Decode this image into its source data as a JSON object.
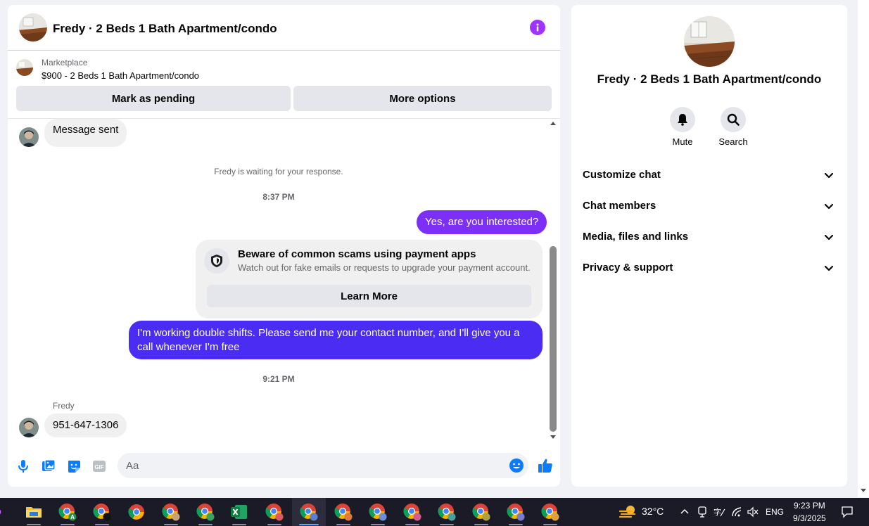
{
  "chat": {
    "title": "Fredy · 2 Beds 1 Bath Apartment/condo",
    "marketplace_label": "Marketplace",
    "listing": "$900 - 2 Beds 1 Bath Apartment/condo",
    "mark_pending": "Mark as pending",
    "more_options": "More options",
    "messages": {
      "m1": "Message sent",
      "waiting": "Fredy is waiting for your response.",
      "t1": "8:37 PM",
      "m2": "Yes, are you interested?",
      "m3": "I'm working double shifts. Please send me your contact number, and I'll give you a call whenever I'm free",
      "t2": "9:21 PM",
      "sender": "Fredy",
      "m4": "951-647-1306"
    },
    "warning": {
      "title": "Beware of common scams using payment apps",
      "subtitle": "Watch out for fake emails or requests to upgrade your payment account.",
      "button": "Learn More"
    },
    "composer_placeholder": "Aa"
  },
  "info": {
    "title": "Fredy · 2 Beds 1 Bath Apartment/condo",
    "mute": "Mute",
    "search": "Search",
    "sections": [
      "Customize chat",
      "Chat members",
      "Media, files and links",
      "Privacy & support"
    ]
  },
  "taskbar": {
    "weather": "32°C",
    "lang": "ENG",
    "time": "9:23 PM",
    "date": "9/3/2025"
  },
  "colors": {
    "accent_purple": "#a033ff",
    "bubble_violet": "#7b2ff7",
    "bubble_indigo": "#4a2cf2",
    "link_blue": "#0a7cff"
  }
}
